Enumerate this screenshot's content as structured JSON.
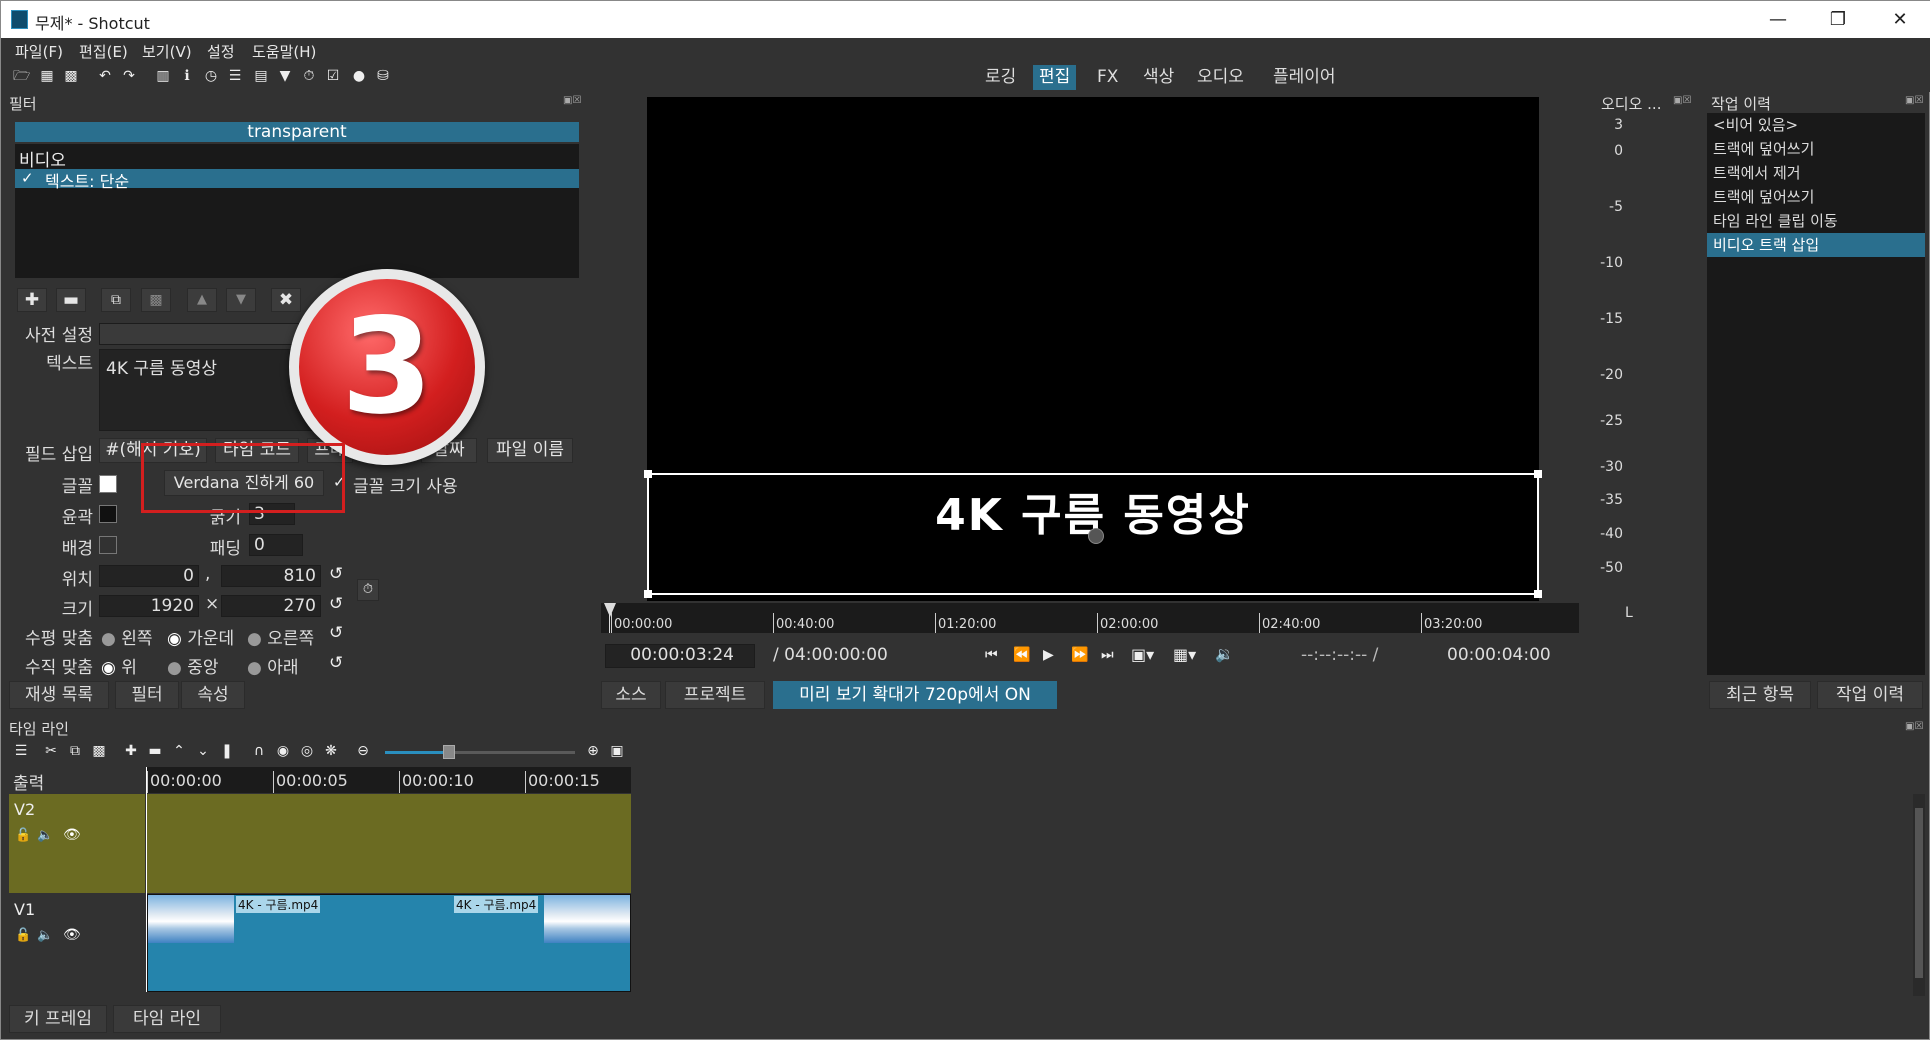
{
  "window": {
    "title": "무제* - Shotcut"
  },
  "menu": [
    "파일(F)",
    "편집(E)",
    "보기(V)",
    "설정",
    "도움말(H)"
  ],
  "workspaces": {
    "items": [
      "로깅",
      "편집",
      "FX",
      "색상",
      "오디오",
      "플레이어"
    ],
    "active": "편집"
  },
  "filters": {
    "panel_title": "필터",
    "clip_name": "transparent",
    "group_label": "비디오",
    "item_check": "✓",
    "item_label": "텍스트: 단순"
  },
  "properties": {
    "preset_label": "사전 설정",
    "text_label": "텍스트",
    "text_value": "4K 구름 동영상",
    "insert_field_label": "필드 삽입",
    "insert_buttons": [
      "#(해시 기호)",
      "타임 코드",
      "프레",
      "날짜",
      "파일 이름"
    ],
    "font_label": "글꼴",
    "font_value": "Verdana 진하게 60",
    "font_size_check": "✓",
    "font_size_label": "글꼴 크기 사용",
    "outline_label": "윤곽",
    "thickness_label": "굵기",
    "thickness_value": "3",
    "bg_label": "배경",
    "padding_label": "패딩",
    "padding_value": "0",
    "position_label": "위치",
    "pos_x": "0",
    "pos_sep": ",",
    "pos_y": "810",
    "size_label": "크기",
    "size_w": "1920",
    "size_sep": "×",
    "size_h": "270",
    "halign_label": "수평 맞춤",
    "halign_options": [
      "왼쪽",
      "가운데",
      "오른쪽"
    ],
    "valign_label": "수직 맞춤",
    "valign_options": [
      "위",
      "중앙",
      "아래"
    ]
  },
  "left_tabs": [
    "재생 목록",
    "필터",
    "속성"
  ],
  "marker": {
    "number": "3"
  },
  "player": {
    "overlay_text": "4K 구름 동영상",
    "ruler_ticks": [
      "00:00:00",
      "00:40:00",
      "01:20:00",
      "02:00:00",
      "02:40:00",
      "03:20:00"
    ],
    "current_time": "00:00:03:24",
    "total_time": "/ 04:00:00:00",
    "in_out": "--:--:--:-- /",
    "duration": "00:00:04:00",
    "tabs": [
      "소스",
      "프로젝트"
    ],
    "zoom_notice": "미리 보기 확대가 720p에서 ON"
  },
  "audio_meter": {
    "title": "오디오 ...",
    "scale": [
      "3",
      "0",
      "-5",
      "-10",
      "-15",
      "-20",
      "-25",
      "-30",
      "-35",
      "-40",
      "-50"
    ],
    "channel": "L"
  },
  "history": {
    "title": "작업 이력",
    "items": [
      "<비어 있음>",
      "트랙에 덮어쓰기",
      "트랙에서 제거",
      "트랙에 덮어쓰기",
      "타임 라인 클립 이동",
      "비디오 트랙 삽입"
    ],
    "selected_index": 5,
    "tabs": [
      "최근 항목",
      "작업 이력"
    ]
  },
  "timeline": {
    "title": "타임 라인",
    "output_label": "출력",
    "ticks": [
      "00:00:00",
      "00:00:05",
      "00:00:10",
      "00:00:15"
    ],
    "tracks": [
      {
        "name": "V2",
        "clips": []
      },
      {
        "name": "V1",
        "clips": [
          "4K - 구름.mp4",
          "4K - 구름.mp4"
        ]
      }
    ],
    "bottom_tabs": [
      "키 프레임",
      "타임 라인"
    ]
  },
  "colors": {
    "accent": "#2a6f8e",
    "v2_track": "#6b6b22",
    "v1_clip": "#2584ac",
    "marker_red": "#d31f1f"
  }
}
